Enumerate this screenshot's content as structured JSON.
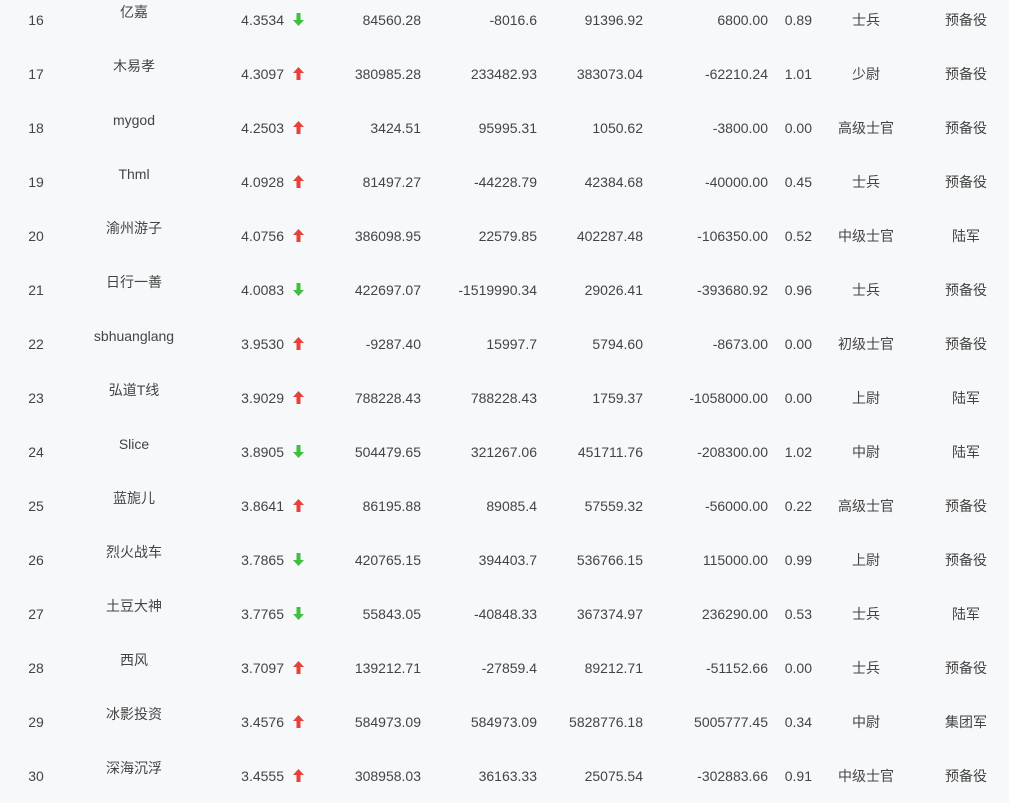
{
  "colors": {
    "up": "#e8413a",
    "down": "#3fbf3f"
  },
  "rows": [
    {
      "rank": "16",
      "name": "亿嘉",
      "score": "4.3534",
      "trend": "down",
      "v1": "84560.28",
      "v2": "-8016.6",
      "v3": "91396.92",
      "v4": "6800.00",
      "ratio": "0.89",
      "military_rank": "士兵",
      "group": "预备役"
    },
    {
      "rank": "17",
      "name": "木易孝",
      "score": "4.3097",
      "trend": "up",
      "v1": "380985.28",
      "v2": "233482.93",
      "v3": "383073.04",
      "v4": "-62210.24",
      "ratio": "1.01",
      "military_rank": "少尉",
      "group": "预备役"
    },
    {
      "rank": "18",
      "name": "mygod",
      "score": "4.2503",
      "trend": "up",
      "v1": "3424.51",
      "v2": "95995.31",
      "v3": "1050.62",
      "v4": "-3800.00",
      "ratio": "0.00",
      "military_rank": "高级士官",
      "group": "预备役"
    },
    {
      "rank": "19",
      "name": "Thml",
      "score": "4.0928",
      "trend": "up",
      "v1": "81497.27",
      "v2": "-44228.79",
      "v3": "42384.68",
      "v4": "-40000.00",
      "ratio": "0.45",
      "military_rank": "士兵",
      "group": "预备役"
    },
    {
      "rank": "20",
      "name": "渝州游子",
      "score": "4.0756",
      "trend": "up",
      "v1": "386098.95",
      "v2": "22579.85",
      "v3": "402287.48",
      "v4": "-106350.00",
      "ratio": "0.52",
      "military_rank": "中级士官",
      "group": "陆军"
    },
    {
      "rank": "21",
      "name": "日行一善",
      "score": "4.0083",
      "trend": "down",
      "v1": "422697.07",
      "v2": "-1519990.34",
      "v3": "29026.41",
      "v4": "-393680.92",
      "ratio": "0.96",
      "military_rank": "士兵",
      "group": "预备役"
    },
    {
      "rank": "22",
      "name": "sbhuanglang",
      "score": "3.9530",
      "trend": "up",
      "v1": "-9287.40",
      "v2": "15997.7",
      "v3": "5794.60",
      "v4": "-8673.00",
      "ratio": "0.00",
      "military_rank": "初级士官",
      "group": "预备役"
    },
    {
      "rank": "23",
      "name": "弘道T线",
      "score": "3.9029",
      "trend": "up",
      "v1": "788228.43",
      "v2": "788228.43",
      "v3": "1759.37",
      "v4": "-1058000.00",
      "ratio": "0.00",
      "military_rank": "上尉",
      "group": "陆军"
    },
    {
      "rank": "24",
      "name": "Slice",
      "score": "3.8905",
      "trend": "down",
      "v1": "504479.65",
      "v2": "321267.06",
      "v3": "451711.76",
      "v4": "-208300.00",
      "ratio": "1.02",
      "military_rank": "中尉",
      "group": "陆军"
    },
    {
      "rank": "25",
      "name": "蓝旎儿",
      "score": "3.8641",
      "trend": "up",
      "v1": "86195.88",
      "v2": "89085.4",
      "v3": "57559.32",
      "v4": "-56000.00",
      "ratio": "0.22",
      "military_rank": "高级士官",
      "group": "预备役"
    },
    {
      "rank": "26",
      "name": "烈火战车",
      "score": "3.7865",
      "trend": "down",
      "v1": "420765.15",
      "v2": "394403.7",
      "v3": "536766.15",
      "v4": "115000.00",
      "ratio": "0.99",
      "military_rank": "上尉",
      "group": "预备役"
    },
    {
      "rank": "27",
      "name": "土豆大神",
      "score": "3.7765",
      "trend": "down",
      "v1": "55843.05",
      "v2": "-40848.33",
      "v3": "367374.97",
      "v4": "236290.00",
      "ratio": "0.53",
      "military_rank": "士兵",
      "group": "陆军"
    },
    {
      "rank": "28",
      "name": "西风",
      "score": "3.7097",
      "trend": "up",
      "v1": "139212.71",
      "v2": "-27859.4",
      "v3": "89212.71",
      "v4": "-51152.66",
      "ratio": "0.00",
      "military_rank": "士兵",
      "group": "预备役"
    },
    {
      "rank": "29",
      "name": "冰影投资",
      "score": "3.4576",
      "trend": "up",
      "v1": "584973.09",
      "v2": "584973.09",
      "v3": "5828776.18",
      "v4": "5005777.45",
      "ratio": "0.34",
      "military_rank": "中尉",
      "group": "集团军"
    },
    {
      "rank": "30",
      "name": "深海沉浮",
      "score": "3.4555",
      "trend": "up",
      "v1": "308958.03",
      "v2": "36163.33",
      "v3": "25075.54",
      "v4": "-302883.66",
      "ratio": "0.91",
      "military_rank": "中级士官",
      "group": "预备役"
    }
  ]
}
